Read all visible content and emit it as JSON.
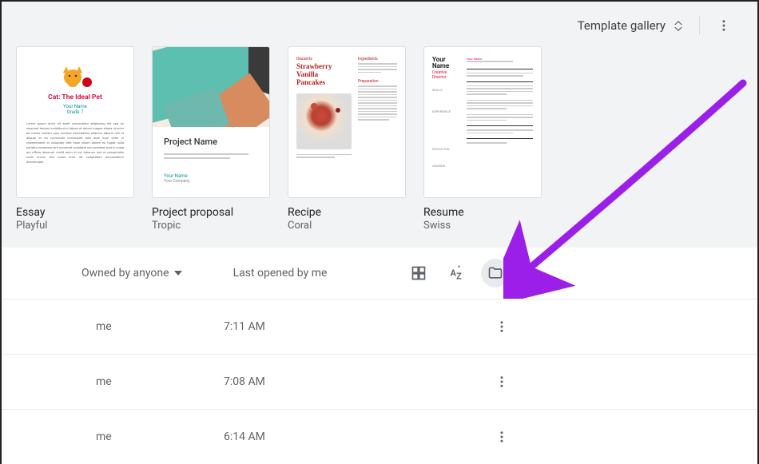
{
  "gallery": {
    "header_label": "Template gallery",
    "templates": [
      {
        "name": "Essay",
        "subtitle": "Playful",
        "thumb_title": "Cat: The Ideal Pet",
        "thumb_sub1": "Your Name",
        "thumb_sub2": "Grade 7"
      },
      {
        "name": "Project proposal",
        "subtitle": "Tropic",
        "thumb_title": "Project Name",
        "thumb_auth1": "Your Name",
        "thumb_auth2": "Your Company"
      },
      {
        "name": "Recipe",
        "subtitle": "Coral",
        "thumb_cat": "Desserts",
        "thumb_title": "Strawberry\nVanilla\nPancakes",
        "thumb_h1": "Ingredients",
        "thumb_h2": "Preparation"
      },
      {
        "name": "Resume",
        "subtitle": "Swiss",
        "thumb_name": "Your\nName",
        "thumb_role": "Creative Director",
        "thumb_sections": [
          "Skills",
          "Experience",
          "Education",
          "Awards"
        ],
        "thumb_contact": "Your Name"
      }
    ]
  },
  "docs": {
    "filter_label": "Owned by anyone",
    "sort_label": "Last opened by me",
    "rows": [
      {
        "owner": "me",
        "time": "7:11 AM"
      },
      {
        "owner": "me",
        "time": "7:08 AM"
      },
      {
        "owner": "me",
        "time": "6:14 AM"
      }
    ]
  },
  "colors": {
    "arrow": "#9b1fe8"
  }
}
